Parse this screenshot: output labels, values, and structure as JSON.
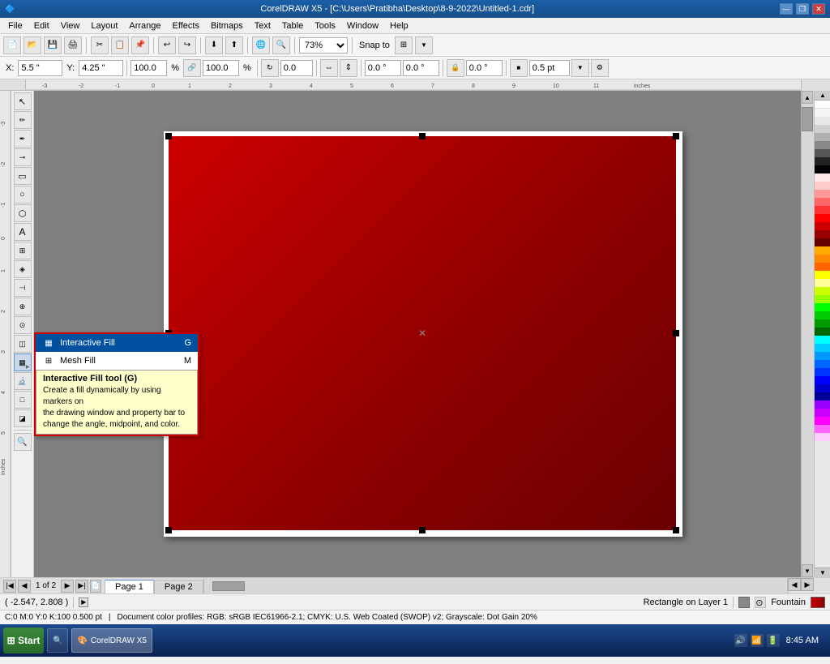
{
  "titlebar": {
    "title": "CorelDRAW X5 - [C:\\Users\\Pratibha\\Desktop\\8-9-2022\\Untitled-1.cdr]",
    "controls": [
      "minimize",
      "restore",
      "close"
    ]
  },
  "menubar": {
    "items": [
      "File",
      "Edit",
      "View",
      "Layout",
      "Arrange",
      "Effects",
      "Bitmaps",
      "Text",
      "Table",
      "Tools",
      "Window",
      "Help"
    ]
  },
  "toolbar1": {
    "zoom_value": "73%",
    "snap_label": "Snap to",
    "x_label": "X:",
    "x_value": "5.5 \"",
    "y_label": "Y:",
    "y_value": "4.25 \"",
    "w_value": "100.0",
    "h_value": "100.0",
    "percent": "%"
  },
  "toolbar2": {
    "x_val": "0.0",
    "y_val": "0.0",
    "angle": "0.0 °",
    "stroke": "0.5 pt"
  },
  "canvas": {
    "background": "#808080",
    "page_bg": "white",
    "rect_color_top": "#cc0000",
    "rect_color_bottom": "#6b0000"
  },
  "popup": {
    "items": [
      {
        "label": "Interactive Fill",
        "shortcut": "G",
        "icon": "gradient-icon"
      },
      {
        "label": "Mesh Fill",
        "shortcut": "M",
        "icon": "mesh-icon"
      }
    ],
    "tooltip": {
      "title": "Interactive Fill tool (G)",
      "description": "Create a fill dynamically by using markers on\nthe drawing window and property bar to\nchange the angle, midpoint, and color."
    }
  },
  "page_tabs": {
    "current": "1 of 2",
    "tabs": [
      "Page 1",
      "Page 2"
    ]
  },
  "status": {
    "coords": "( -2.547, 2.808 )",
    "layer_info": "Rectangle on Layer 1",
    "fill_type": "Fountain",
    "color_info": "C:0 M:0 Y:0 K:100  0.500 pt",
    "doc_profiles": "Document color profiles: RGB: sRGB IEC61966-2.1; CMYK: U.S. Web Coated (SWOP) v2; Grayscale: Dot Gain 20%"
  },
  "taskbar": {
    "start_label": "Start",
    "time": "8:45 AM",
    "apps": [
      "CorelDRAW X5"
    ]
  },
  "colors": {
    "accent_blue": "#1a5fa8",
    "dark_red": "#8b0000",
    "bright_red": "#cc0000",
    "selection_blue": "#0050a0",
    "tooltip_bg": "#ffffcc",
    "popup_border": "#cc0000"
  }
}
